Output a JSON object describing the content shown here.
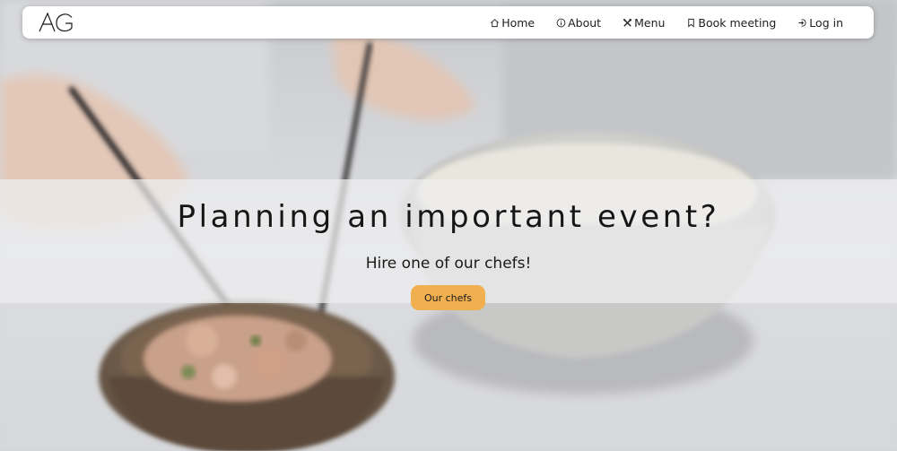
{
  "logo": {
    "text": "AG"
  },
  "nav": {
    "items": [
      {
        "label": "Home",
        "icon": "home-icon"
      },
      {
        "label": "About",
        "icon": "info-icon"
      },
      {
        "label": "Menu",
        "icon": "utensils-icon"
      },
      {
        "label": "Book meeting",
        "icon": "bookmark-icon"
      },
      {
        "label": "Log in",
        "icon": "login-icon"
      }
    ]
  },
  "hero": {
    "title": "Planning an important event?",
    "subtitle": "Hire one of our chefs!",
    "cta_label": "Our chefs"
  },
  "colors": {
    "accent": "#f0b050",
    "navbar_bg": "#ffffff",
    "text": "#161616"
  }
}
